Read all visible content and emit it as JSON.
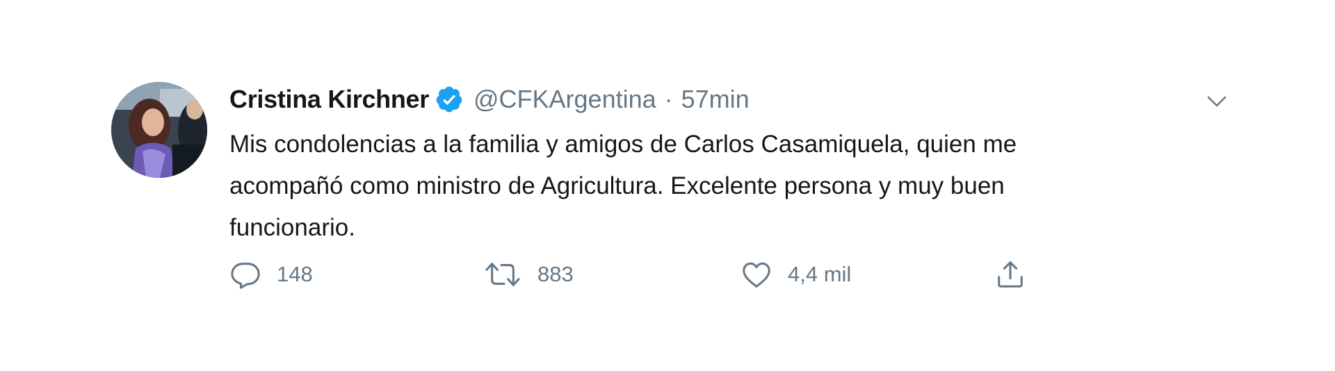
{
  "tweet": {
    "author": {
      "display_name": "Cristina Kirchner",
      "handle": "@CFKArgentina",
      "verified": true
    },
    "separator": "·",
    "timestamp": "57min",
    "text_lines": [
      "Mis condolencias a la familia y amigos de Carlos Casamiquela, quien me",
      "acompañó como ministro de Agricultura. Excelente persona y muy buen",
      "funcionario."
    ],
    "actions": {
      "reply_count": "148",
      "retweet_count": "883",
      "like_count": "4,4 mil"
    }
  },
  "colors": {
    "text_primary": "#14171a",
    "text_secondary": "#657786",
    "verified_blue": "#1da1f2"
  },
  "icons": [
    "avatar",
    "verified-badge-icon",
    "chevron-down-icon",
    "reply-icon",
    "retweet-icon",
    "like-icon",
    "share-icon"
  ]
}
